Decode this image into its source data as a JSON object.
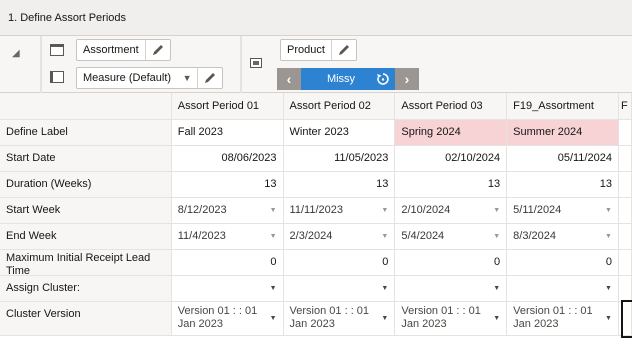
{
  "window": {
    "title": "1. Define Assort Periods"
  },
  "pivot": {
    "row_dimension": "Assortment",
    "measure_dimension": "Measure (Default)",
    "column_dimension": "Product",
    "navigator": {
      "current": "Missy",
      "prev_icon": "chevron-left-icon",
      "next_icon": "chevron-right-icon"
    }
  },
  "grid": {
    "columns": [
      "Assort Period 01",
      "Assort Period 02",
      "Assort Period 03",
      "F19_Assortment",
      "F"
    ],
    "rows": [
      {
        "label": "Define Label",
        "cells": [
          "Fall 2023",
          "Winter 2023",
          "Spring 2024",
          "Summer 2024",
          ""
        ]
      },
      {
        "label": "Start Date",
        "cells": [
          "08/06/2023",
          "11/05/2023",
          "02/10/2024",
          "05/11/2024",
          ""
        ]
      },
      {
        "label": "Duration (Weeks)",
        "cells": [
          "13",
          "13",
          "13",
          "13",
          ""
        ]
      },
      {
        "label": "Start Week",
        "cells": [
          "8/12/2023",
          "11/11/2023",
          "2/10/2024",
          "5/11/2024",
          ""
        ]
      },
      {
        "label": "End Week",
        "cells": [
          "11/4/2023",
          "2/3/2024",
          "5/4/2024",
          "8/3/2024",
          ""
        ]
      },
      {
        "label": "Maximum Initial Receipt Lead Time",
        "cells": [
          "0",
          "0",
          "0",
          "0",
          ""
        ]
      },
      {
        "label": "Assign Cluster:",
        "cells": [
          "",
          "",
          "",
          "",
          ""
        ]
      },
      {
        "label": "Cluster Version",
        "cells": [
          "Version 01 : : 01 Jan 2023",
          "Version 01 : : 01 Jan 2023",
          "Version 01 : : 01 Jan 2023",
          "Version 01 : : 01 Jan 2023",
          ""
        ]
      }
    ]
  },
  "colors": {
    "highlight": "#f7d3d6",
    "navigator": "#2d82d2",
    "header_bg": "#f7f6f5"
  }
}
